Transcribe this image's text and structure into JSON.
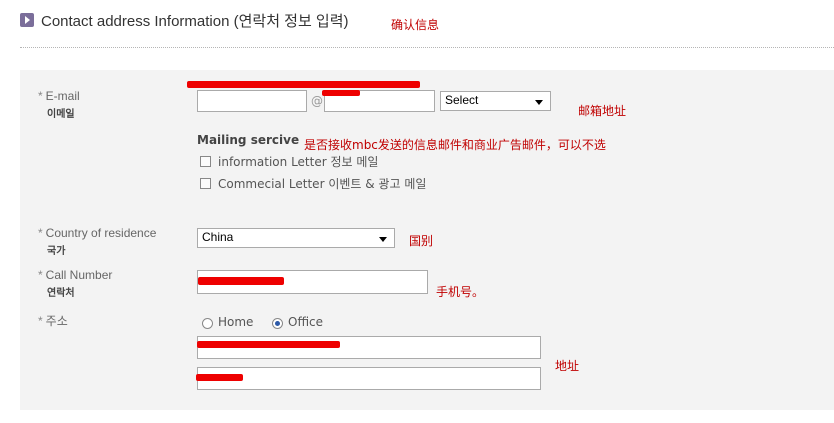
{
  "header": {
    "title": "Contact address Information (연락처 정보 입력)",
    "note": "确认信息"
  },
  "email": {
    "label": "E-mail",
    "sub": "이메일",
    "at": "@",
    "domain_select": "Select",
    "note": "邮箱地址"
  },
  "mailing": {
    "title": "Mailing sercive",
    "note": "是否接收mbc发送的信息邮件和商业广告邮件，可以不选",
    "options": [
      {
        "label": "information Letter 정보 메일",
        "checked": false
      },
      {
        "label": "Commecial Letter 이벤트 & 광고 메일",
        "checked": false
      }
    ]
  },
  "country": {
    "label": "Country of residence",
    "sub": "국가",
    "value": "China",
    "note": "国别"
  },
  "call": {
    "label": "Call Number",
    "sub": "연락처",
    "note": "手机号。"
  },
  "address": {
    "label": "주소",
    "radio_home": "Home",
    "radio_office": "Office",
    "selected": "Office",
    "note": "地址"
  },
  "required_mark": "*",
  "colors": {
    "annotation": "#c00000",
    "redaction": "#ee0000",
    "panel": "#f3f3f3"
  }
}
